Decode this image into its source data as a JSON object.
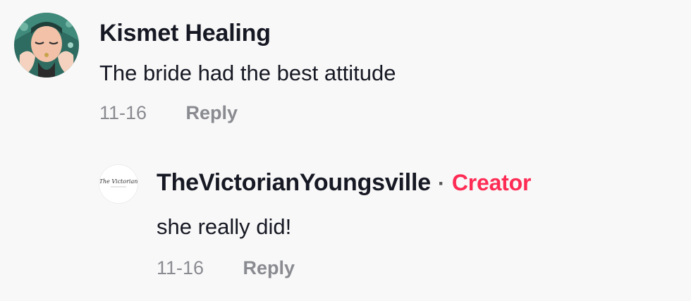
{
  "comments": [
    {
      "username": "Kismet Healing",
      "text": "The bride had the best attitude",
      "date": "11-16",
      "reply_label": "Reply"
    }
  ],
  "replies": [
    {
      "username": "TheVictorianYoungsville",
      "separator": "·",
      "badge": "Creator",
      "text": "she really did!",
      "date": "11-16",
      "reply_label": "Reply",
      "avatar_logo_text": "The Victorian"
    }
  ],
  "colors": {
    "background": "#f8f8f8",
    "text": "#161823",
    "muted": "#8a8b91",
    "creator_badge": "#fe2c55"
  },
  "icons": {
    "comment_avatar": "illustrated-face-avatar",
    "reply_avatar": "script-logo-avatar"
  }
}
